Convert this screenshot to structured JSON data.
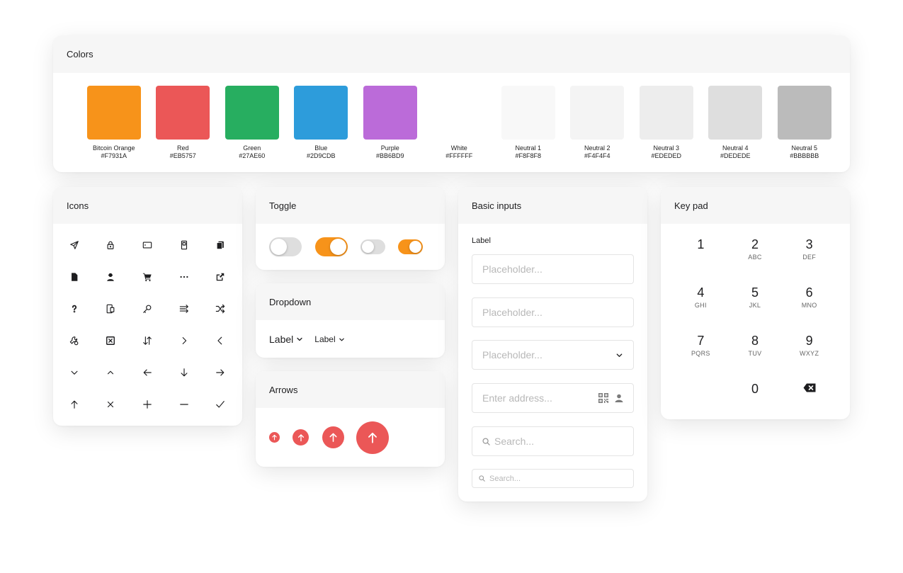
{
  "colors": {
    "title": "Colors",
    "swatches": [
      {
        "name": "Bitcoin Orange",
        "hex": "#F7931A",
        "color": "#F7931A"
      },
      {
        "name": "Red",
        "hex": "#EB5757",
        "color": "#EB5757"
      },
      {
        "name": "Green",
        "hex": "#27AE60",
        "color": "#27AE60"
      },
      {
        "name": "Blue",
        "hex": "#2D9CDB",
        "color": "#2D9CDB"
      },
      {
        "name": "Purple",
        "hex": "#BB6BD9",
        "color": "#BB6BD9"
      },
      {
        "name": "White",
        "hex": "#FFFFFF",
        "color": "#FFFFFF"
      },
      {
        "name": "Neutral 1",
        "hex": "#F8F8F8",
        "color": "#F8F8F8"
      },
      {
        "name": "Neutral 2",
        "hex": "#F4F4F4",
        "color": "#F4F4F4"
      },
      {
        "name": "Neutral 3",
        "hex": "#EDEDED",
        "color": "#EDEDED"
      },
      {
        "name": "Neutral 4",
        "hex": "#DEDEDE",
        "color": "#DEDEDE"
      },
      {
        "name": "Neutral 5",
        "hex": "#BBBBBB",
        "color": "#BBBBBB"
      }
    ]
  },
  "icons": {
    "title": "Icons",
    "items": [
      "send-icon",
      "lock-icon",
      "card-icon",
      "device-icon",
      "copy-icon",
      "document-icon",
      "user-icon",
      "cart-icon",
      "more-icon",
      "external-link-icon",
      "help-icon",
      "mobile-icon",
      "key-icon",
      "transfer-icon",
      "shuffle-icon",
      "settings-icon",
      "close-box-icon",
      "sort-icon",
      "chevron-right-icon",
      "chevron-left-icon",
      "chevron-down-icon",
      "chevron-up-icon",
      "arrow-left-icon",
      "arrow-down-icon",
      "arrow-right-icon",
      "arrow-up-icon",
      "close-icon",
      "plus-icon",
      "minus-icon",
      "check-icon"
    ]
  },
  "toggle": {
    "title": "Toggle",
    "items": [
      {
        "size": "large",
        "state": "off"
      },
      {
        "size": "large",
        "state": "on"
      },
      {
        "size": "small",
        "state": "off"
      },
      {
        "size": "small",
        "state": "on"
      }
    ],
    "on_color": "#F7931A",
    "off_color": "#DEDEDE"
  },
  "dropdown": {
    "title": "Dropdown",
    "large_label": "Label",
    "small_label": "Label"
  },
  "arrows": {
    "title": "Arrows",
    "color": "#EB5757"
  },
  "inputs": {
    "title": "Basic inputs",
    "label": "Label",
    "text1_placeholder": "Placeholder...",
    "text2_placeholder": "Placeholder...",
    "select_placeholder": "Placeholder...",
    "address_placeholder": "Enter address...",
    "search_placeholder": "Search...",
    "search_small_placeholder": "Search..."
  },
  "keypad": {
    "title": "Key pad",
    "keys": [
      {
        "digit": "1",
        "letters": ""
      },
      {
        "digit": "2",
        "letters": "ABC"
      },
      {
        "digit": "3",
        "letters": "DEF"
      },
      {
        "digit": "4",
        "letters": "GHI"
      },
      {
        "digit": "5",
        "letters": "JKL"
      },
      {
        "digit": "6",
        "letters": "MNO"
      },
      {
        "digit": "7",
        "letters": "PQRS"
      },
      {
        "digit": "8",
        "letters": "TUV"
      },
      {
        "digit": "9",
        "letters": "WXYZ"
      },
      {
        "digit": "0",
        "letters": ""
      }
    ],
    "delete_icon": "backspace-icon"
  }
}
